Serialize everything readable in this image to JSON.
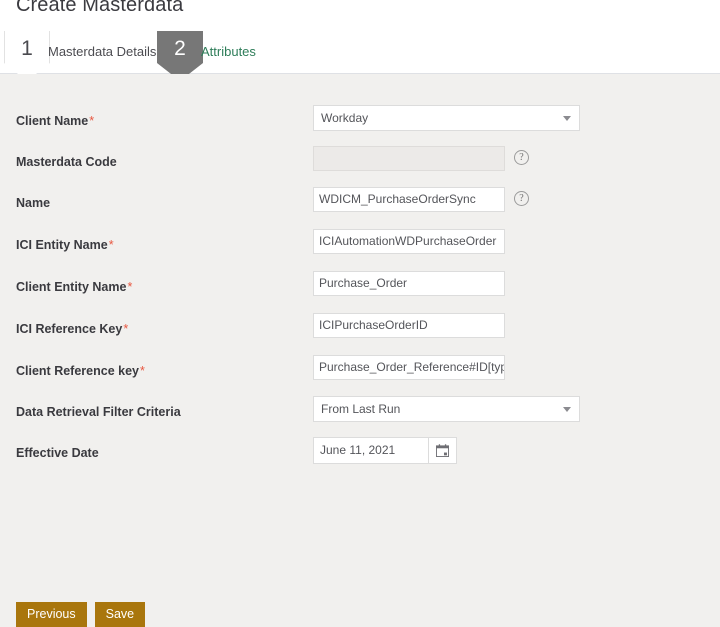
{
  "header": {
    "title": "Create Masterdata"
  },
  "wizard": {
    "steps": [
      {
        "number": "1",
        "label": "Masterdata Details",
        "state": "inactive"
      },
      {
        "number": "2",
        "label": "Attributes",
        "state": "active"
      }
    ]
  },
  "form": {
    "fields": [
      {
        "label": "Client Name",
        "required": "*",
        "type": "select",
        "value": "Workday",
        "icon": "chevron-down-icon",
        "name": "client-name"
      },
      {
        "label": "Masterdata Code",
        "required": "",
        "type": "text-disabled",
        "value": "",
        "help": "?",
        "name": "masterdata-code"
      },
      {
        "label": "Name",
        "required": "",
        "type": "text",
        "value": "WDICM_PurchaseOrderSync",
        "help": "?",
        "name": "name"
      },
      {
        "label": "ICI Entity Name",
        "required": "*",
        "type": "text",
        "value": "ICIAutomationWDPurchaseOrder",
        "name": "ici-entity-name"
      },
      {
        "label": "Client Entity Name",
        "required": "*",
        "type": "text",
        "value": "Purchase_Order",
        "name": "client-entity-name"
      },
      {
        "label": "ICI Reference Key",
        "required": "*",
        "type": "text",
        "value": "ICIPurchaseOrderID",
        "name": "ici-reference-key"
      },
      {
        "label": "Client Reference key",
        "required": "*",
        "type": "text",
        "value": "Purchase_Order_Reference#ID[type=",
        "name": "client-reference-key"
      },
      {
        "label": "Data Retrieval Filter Criteria",
        "required": "",
        "type": "select",
        "value": "From Last Run",
        "icon": "chevron-down-icon",
        "name": "data-retrieval-filter-criteria"
      },
      {
        "label": "Effective Date",
        "required": "",
        "type": "date",
        "value": "June 11, 2021",
        "icon": "calendar-icon",
        "name": "effective-date"
      }
    ]
  },
  "footer": {
    "previous_label": "Previous",
    "save_label": "Save"
  },
  "colors": {
    "page_background": "#f1f0ee",
    "header_background": "#ffffff",
    "active_step": "#777777",
    "active_step_text": "#2e7d59",
    "required_marker": "#e8563f",
    "button": "#a9760d"
  }
}
